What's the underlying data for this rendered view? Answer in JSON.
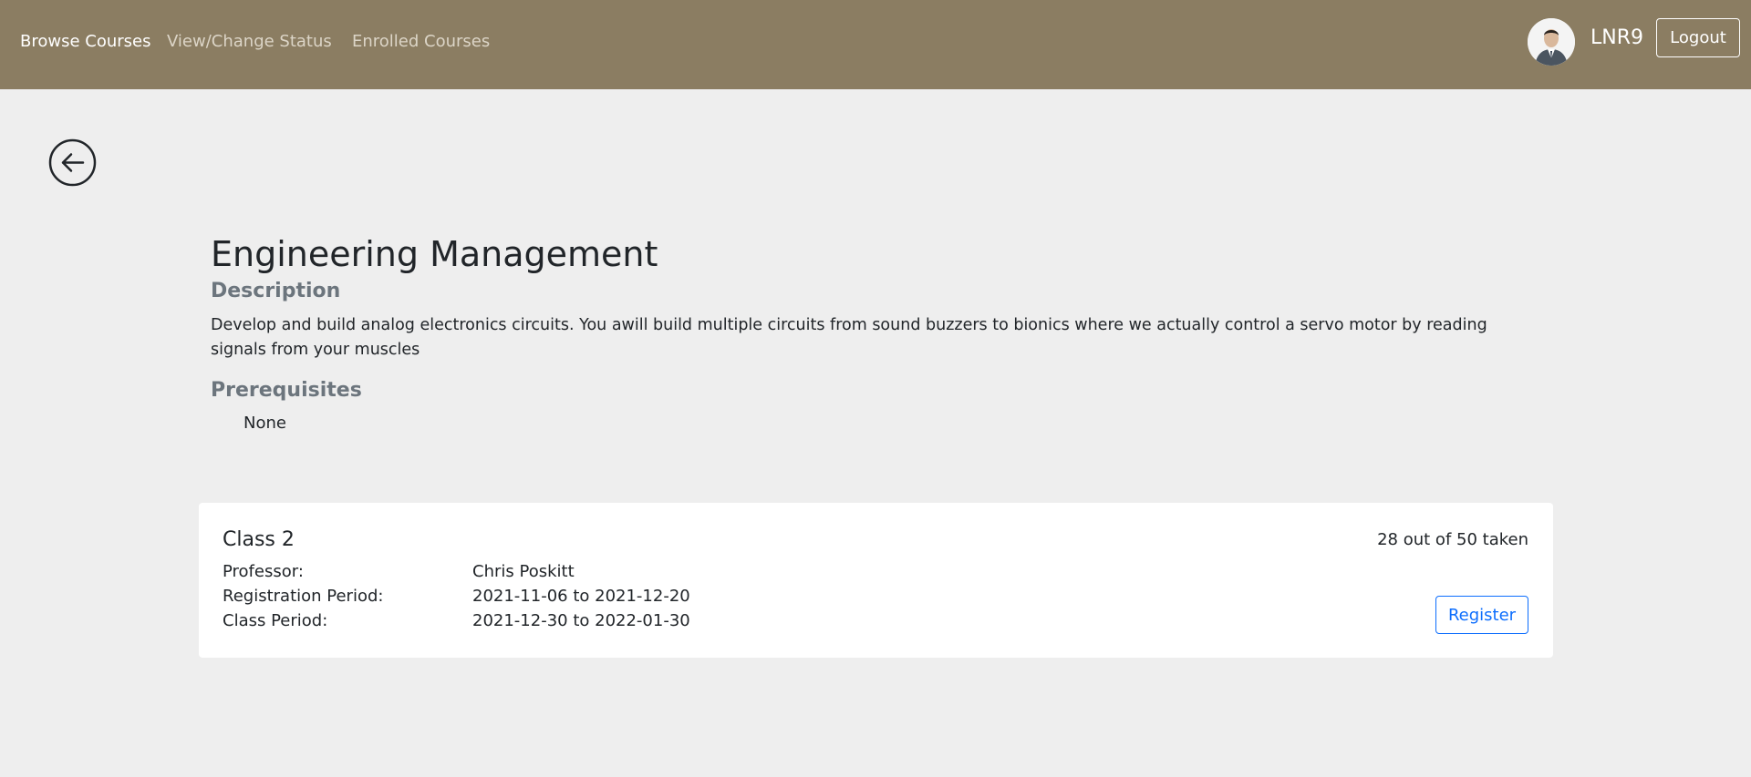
{
  "nav": {
    "links": [
      "Browse Courses",
      "View/Change Status",
      "Enrolled Courses"
    ],
    "username": "LNR9",
    "logout_label": "Logout"
  },
  "icons": {
    "back": "arrow-left-circle-icon",
    "avatar": "user-avatar"
  },
  "colors": {
    "navbar": "#8b7d62",
    "background": "#eeeeee",
    "accent": "#0d6efd"
  },
  "course": {
    "title": "Engineering Management",
    "description_heading": "Description",
    "description": "Develop and build analog electronics circuits. You awill build multiple circuits from sound buzzers to bionics where we actually control a servo motor by reading signals from your muscles",
    "prerequisites_heading": "Prerequisites",
    "prerequisites": [
      "None"
    ]
  },
  "class": {
    "name": "Class 2",
    "seats": "28 out of 50 taken",
    "details": [
      {
        "label": "Professor:",
        "value": "Chris Poskitt"
      },
      {
        "label": "Registration Period:",
        "value": "2021-11-06 to 2021-12-20"
      },
      {
        "label": "Class Period:",
        "value": "2021-12-30 to 2022-01-30"
      }
    ],
    "register_label": "Register"
  }
}
